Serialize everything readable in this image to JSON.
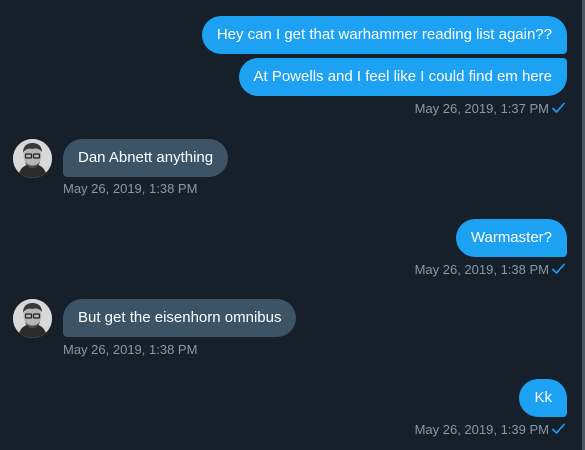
{
  "conversation": {
    "messages": [
      {
        "direction": "outgoing",
        "text": "Hey can I get that warhammer reading list again??"
      },
      {
        "direction": "outgoing",
        "text": "At Powells and I feel like I could find em here",
        "timestamp": "May 26, 2019, 1:37 PM",
        "read": true
      },
      {
        "direction": "incoming",
        "text": "Dan Abnett anything",
        "timestamp": "May 26, 2019, 1:38 PM"
      },
      {
        "direction": "outgoing",
        "text": "Warmaster?",
        "timestamp": "May 26, 2019, 1:38 PM",
        "read": true
      },
      {
        "direction": "incoming",
        "text": "But get the eisenhorn omnibus",
        "timestamp": "May 26, 2019, 1:38 PM"
      },
      {
        "direction": "outgoing",
        "text": "Kk",
        "timestamp": "May 26, 2019, 1:39 PM",
        "read": true
      }
    ]
  },
  "icons": {
    "read_receipt": "check-icon",
    "avatar": "user-avatar"
  },
  "colors": {
    "background": "#15202b",
    "outgoing_bubble": "#1da1f2",
    "incoming_bubble": "#3d5466",
    "timestamp_text": "#8899a6",
    "read_check": "#1da1f2"
  }
}
